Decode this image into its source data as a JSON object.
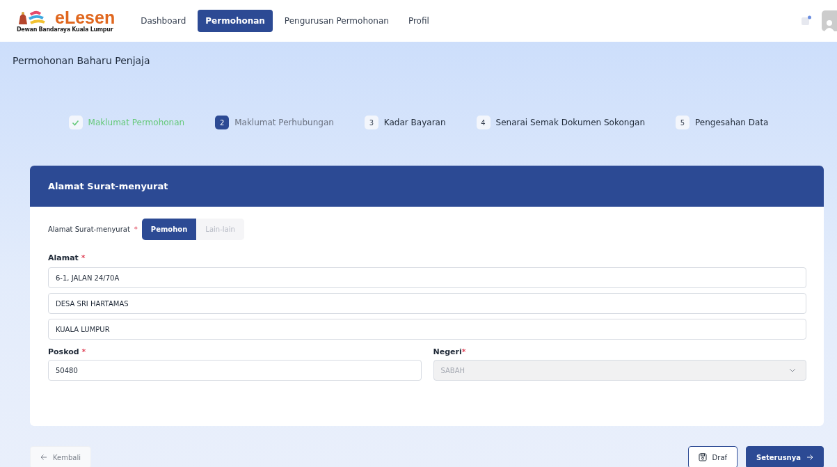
{
  "header": {
    "logo": {
      "name": "eLesen",
      "subtitle": "Dewan Bandaraya Kuala Lumpur"
    },
    "nav": [
      {
        "label": "Dashboard",
        "selected": false
      },
      {
        "label": "Permohonan",
        "selected": true
      },
      {
        "label": "Pengurusan Permohonan",
        "selected": false
      },
      {
        "label": "Profil",
        "selected": false
      }
    ]
  },
  "page_title": "Permohonan Baharu Penjaja",
  "steps": [
    {
      "label": "Maklumat Permohonan",
      "completed": true,
      "selected": false
    },
    {
      "number": "2",
      "label": "Maklumat Perhubungan",
      "completed": false,
      "selected": true
    },
    {
      "number": "3",
      "label": "Kadar Bayaran",
      "completed": false,
      "selected": false
    },
    {
      "number": "4",
      "label": "Senarai Semak Dokumen Sokongan",
      "completed": false,
      "selected": false
    },
    {
      "number": "5",
      "label": "Pengesahan Data",
      "completed": false,
      "selected": false
    }
  ],
  "card": {
    "title": "Alamat Surat-menyurat",
    "toggle": {
      "label": "Alamat Surat-menyurat",
      "required_mark": "*",
      "options": [
        {
          "label": "Pemohon",
          "selected": true
        },
        {
          "label": "Lain-lain",
          "selected": false
        }
      ]
    },
    "address": {
      "label": "Alamat",
      "required_mark": "*",
      "lines": [
        "6-1, JALAN 24/70A",
        "DESA SRI HARTAMAS",
        "KUALA LUMPUR"
      ]
    },
    "postcode": {
      "label": "Poskod",
      "required_mark": "*",
      "value": "50480"
    },
    "state": {
      "label": "Negeri",
      "required_mark": "*",
      "value": "SABAH",
      "disabled": true
    }
  },
  "footer": {
    "back": {
      "label": "Kembali",
      "disabled": true
    },
    "draft": {
      "label": "Draf"
    },
    "next": {
      "label": "Seterusnya"
    }
  }
}
